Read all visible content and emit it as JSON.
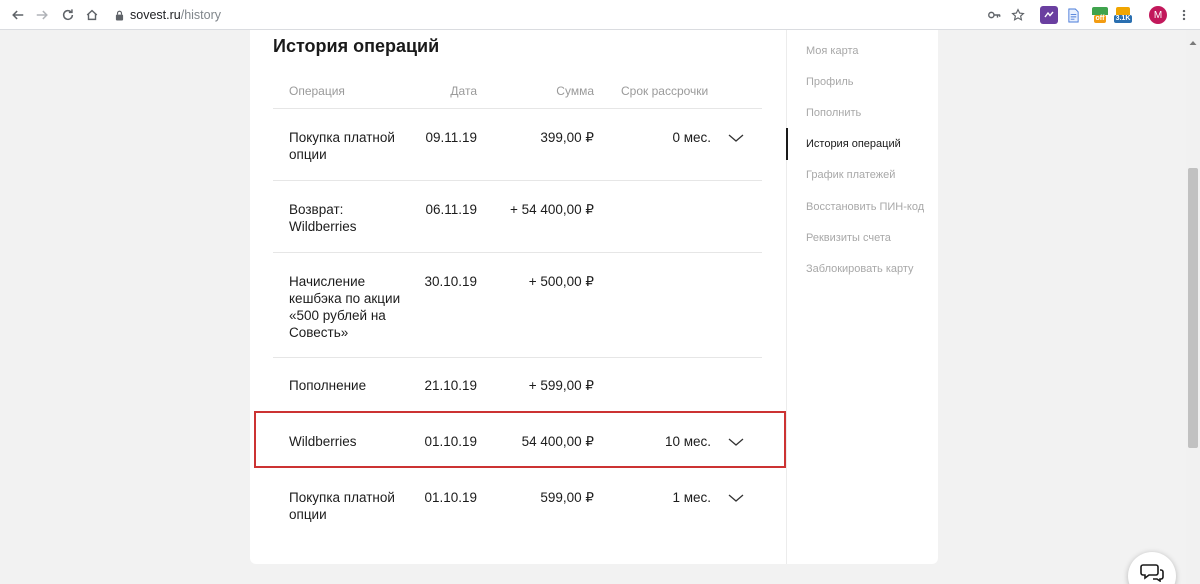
{
  "browser": {
    "url_host": "sovest.ru",
    "url_path": "/history",
    "ext_badge_off": "off",
    "ext_badge_count": "3.1K",
    "profile_initial": "M"
  },
  "page": {
    "title": "История операций",
    "columns": [
      "Операция",
      "Дата",
      "Сумма",
      "Срок рассрочки"
    ],
    "rows": [
      {
        "operation": "Покупка платной опции",
        "date": "09.11.19",
        "amount": "399,00 ₽",
        "term": "0 мес.",
        "expandable": true
      },
      {
        "operation": "Возврат: Wildberries",
        "date": "06.11.19",
        "amount": "+ 54 400,00 ₽",
        "term": "",
        "expandable": false
      },
      {
        "operation": "Начисление кешбэка по акции «500 рублей на Совесть»",
        "date": "30.10.19",
        "amount": "+ 500,00 ₽",
        "term": "",
        "expandable": false
      },
      {
        "operation": "Пополнение",
        "date": "21.10.19",
        "amount": "+ 599,00 ₽",
        "term": "",
        "expandable": false
      },
      {
        "operation": "Wildberries",
        "date": "01.10.19",
        "amount": "54 400,00 ₽",
        "term": "10 мес.",
        "expandable": true
      },
      {
        "operation": "Покупка платной опции",
        "date": "01.10.19",
        "amount": "599,00 ₽",
        "term": "1 мес.",
        "expandable": true
      }
    ]
  },
  "sidebar": {
    "items": [
      {
        "label": "Моя карта",
        "active": false
      },
      {
        "label": "Профиль",
        "active": false
      },
      {
        "label": "Пополнить",
        "active": false
      },
      {
        "label": "История операций",
        "active": true
      },
      {
        "label": "График платежей",
        "active": false
      },
      {
        "label": "Восстановить ПИН-код",
        "active": false
      },
      {
        "label": "Реквизиты счета",
        "active": false
      },
      {
        "label": "Заблокировать карту",
        "active": false
      }
    ]
  },
  "colors": {
    "highlight": "#cc3333",
    "profile": "#c2185b",
    "ext_purple": "#6a3fa0"
  }
}
